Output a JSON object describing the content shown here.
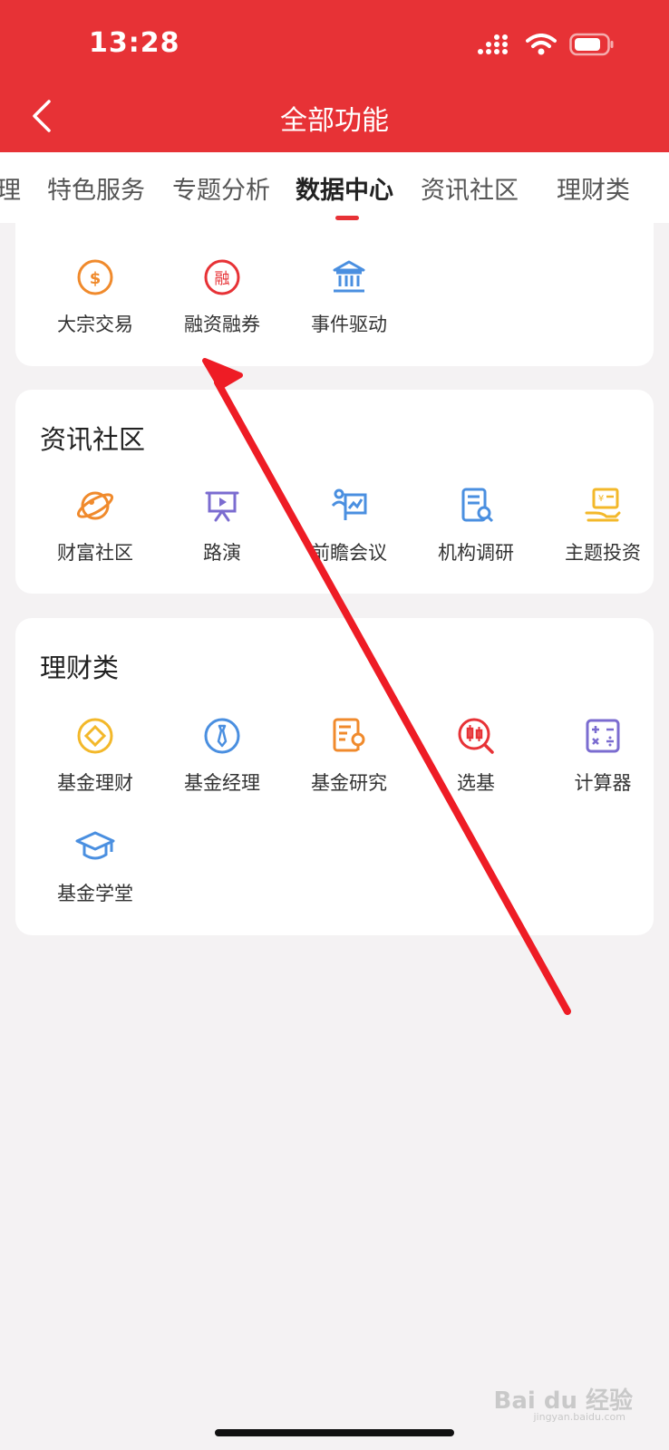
{
  "status": {
    "time": "13:28"
  },
  "header": {
    "title": "全部功能"
  },
  "tabs": [
    {
      "label": "理"
    },
    {
      "label": "特色服务"
    },
    {
      "label": "专题分析"
    },
    {
      "label": "数据中心",
      "active": true
    },
    {
      "label": "资讯社区"
    },
    {
      "label": "理财类"
    }
  ],
  "data_center": {
    "items": [
      {
        "label": "大宗交易",
        "icon": "dollar-circle-icon"
      },
      {
        "label": "融资融券",
        "icon": "margin-trading-icon"
      },
      {
        "label": "事件驱动",
        "icon": "bank-building-icon"
      }
    ]
  },
  "news": {
    "title": "资讯社区",
    "items": [
      {
        "label": "财富社区",
        "icon": "planet-icon"
      },
      {
        "label": "路演",
        "icon": "presentation-icon"
      },
      {
        "label": "前瞻会议",
        "icon": "meeting-chart-icon"
      },
      {
        "label": "机构调研",
        "icon": "document-search-icon"
      },
      {
        "label": "主题投资",
        "icon": "hand-money-icon"
      }
    ]
  },
  "finance": {
    "title": "理财类",
    "items": [
      {
        "label": "基金理财",
        "icon": "coin-diamond-icon"
      },
      {
        "label": "基金经理",
        "icon": "manager-tie-icon"
      },
      {
        "label": "基金研究",
        "icon": "research-doc-icon"
      },
      {
        "label": "选基",
        "icon": "candlestick-search-icon"
      },
      {
        "label": "计算器",
        "icon": "calculator-icon"
      },
      {
        "label": "基金学堂",
        "icon": "graduation-cap-icon"
      }
    ]
  },
  "watermark": {
    "text": "Bai du 经验",
    "sub": "jingyan.baidu.com"
  },
  "colors": {
    "brand_red": "#e73236",
    "orange": "#f08a2c",
    "blue": "#4a8fe0",
    "purple": "#7b6cd0",
    "yellow": "#f3b82a",
    "background": "#f4f2f3"
  }
}
